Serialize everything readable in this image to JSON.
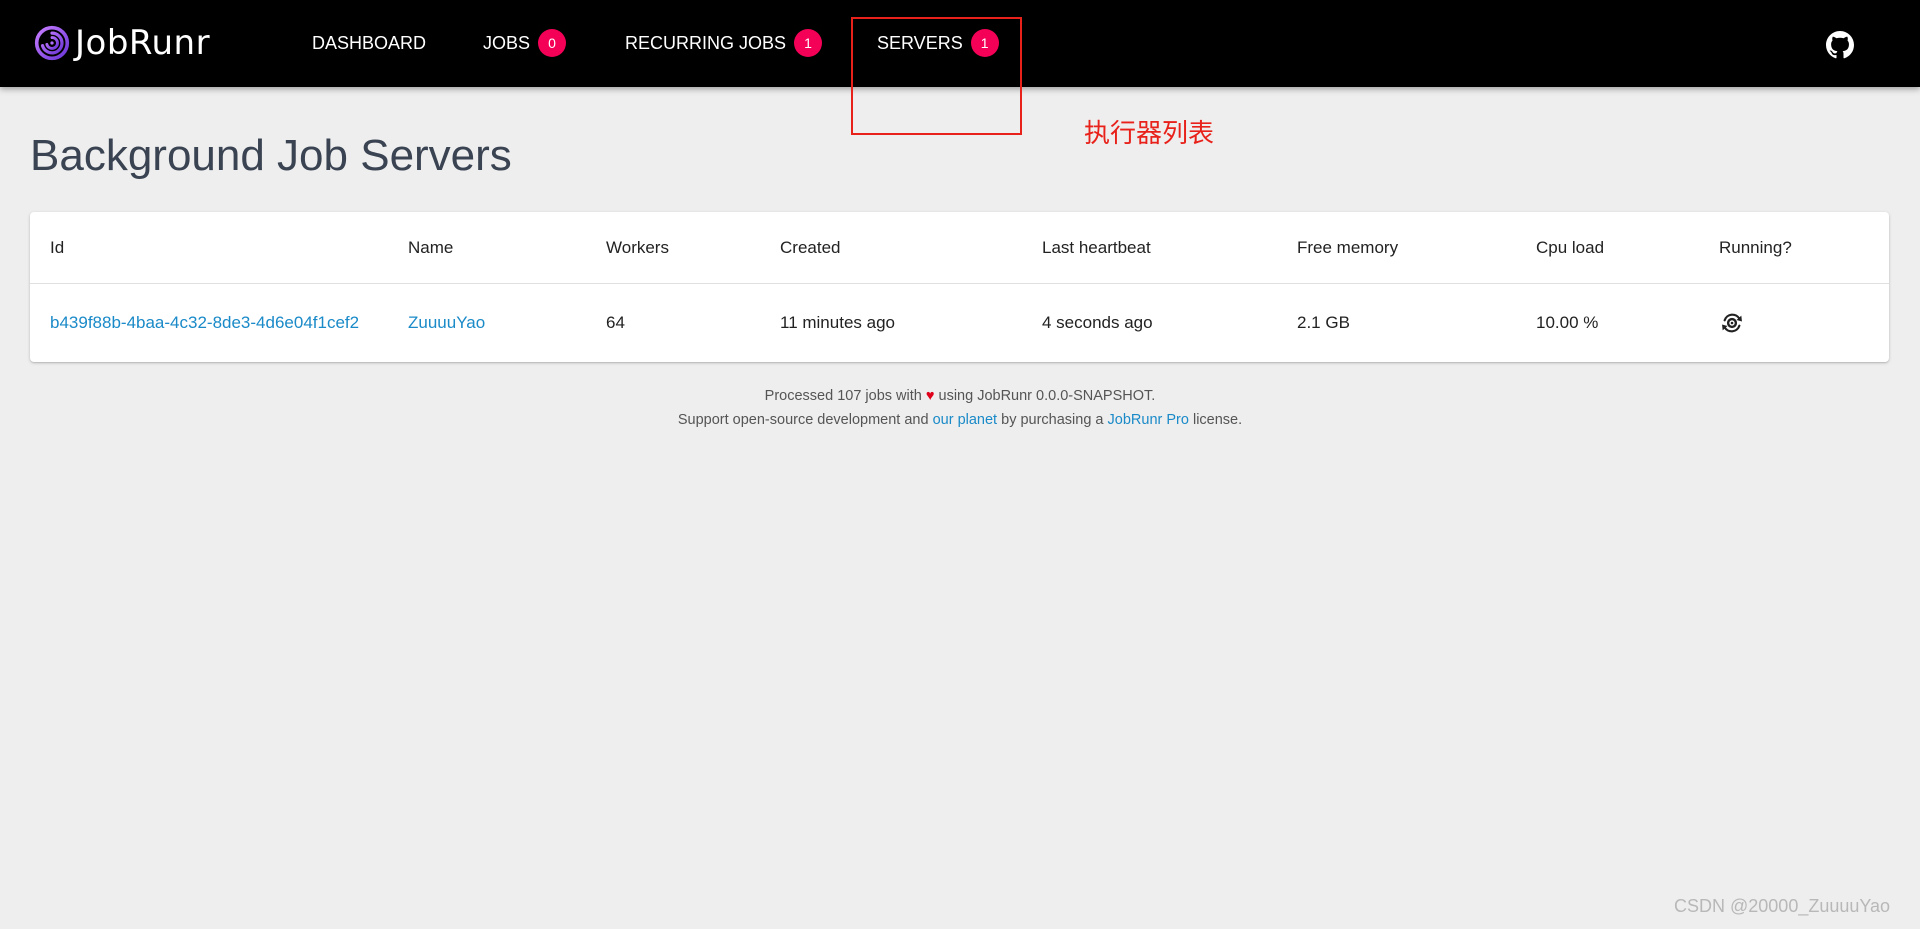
{
  "header": {
    "logo_text": "JobRunr",
    "nav": [
      {
        "label": "DASHBOARD"
      },
      {
        "label": "JOBS",
        "badge": "0"
      },
      {
        "label": "RECURRING JOBS",
        "badge": "1"
      },
      {
        "label": "SERVERS",
        "badge": "1"
      }
    ]
  },
  "annotation": {
    "text": "执行器列表",
    "color": "#e8221b"
  },
  "page": {
    "title": "Background Job Servers"
  },
  "table": {
    "columns": [
      "Id",
      "Name",
      "Workers",
      "Created",
      "Last heartbeat",
      "Free memory",
      "Cpu load",
      "Running?"
    ],
    "rows": [
      {
        "id": "b439f88b-4baa-4c32-8de3-4d6e04f1cef2",
        "name": "ZuuuuYao",
        "workers": "64",
        "created": "11 minutes ago",
        "last_heartbeat": "4 seconds ago",
        "free_memory": "2.1 GB",
        "cpu_load": "10.00 %",
        "running_icon": "running-gear-icon"
      }
    ]
  },
  "footer": {
    "line1_pre": "Processed 107 jobs with",
    "heart": "♥",
    "line1_post": "using JobRunr 0.0.0-SNAPSHOT.",
    "line2_pre": "Support open-source development and",
    "link_planet": "our planet",
    "line2_mid": "by purchasing a",
    "link_pro": "JobRunr Pro",
    "line2_post": "license."
  },
  "watermark": "CSDN @20000_ZuuuuYao",
  "colors": {
    "header_bg": "#000000",
    "badge": "#f50057",
    "link": "#1a8ac8",
    "page_bg": "#eeeeee"
  }
}
